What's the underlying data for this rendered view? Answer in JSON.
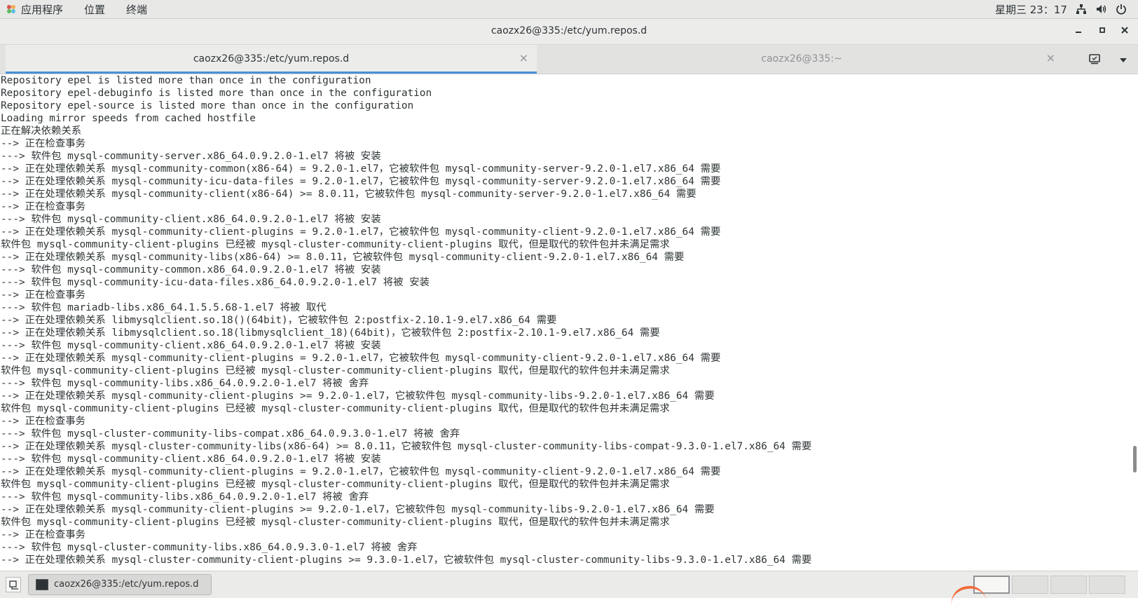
{
  "topbar": {
    "menus": [
      "应用程序",
      "位置",
      "终端"
    ],
    "clock": "星期三 23：17",
    "icons": [
      "apps-icon",
      "network-icon",
      "volume-icon",
      "power-icon"
    ]
  },
  "window": {
    "title": "caozx26@335:/etc/yum.repos.d"
  },
  "tabs": [
    {
      "label": "caozx26@335:/etc/yum.repos.d",
      "active": true
    },
    {
      "label": "caozx26@335:~",
      "active": false
    }
  ],
  "terminal": {
    "lines": [
      "Repository epel is listed more than once in the configuration",
      "Repository epel-debuginfo is listed more than once in the configuration",
      "Repository epel-source is listed more than once in the configuration",
      "Loading mirror speeds from cached hostfile",
      "正在解决依赖关系",
      "--> 正在检查事务",
      "---> 软件包 mysql-community-server.x86_64.0.9.2.0-1.el7 将被 安装",
      "--> 正在处理依赖关系 mysql-community-common(x86-64) = 9.2.0-1.el7，它被软件包 mysql-community-server-9.2.0-1.el7.x86_64 需要",
      "--> 正在处理依赖关系 mysql-community-icu-data-files = 9.2.0-1.el7，它被软件包 mysql-community-server-9.2.0-1.el7.x86_64 需要",
      "--> 正在处理依赖关系 mysql-community-client(x86-64) >= 8.0.11，它被软件包 mysql-community-server-9.2.0-1.el7.x86_64 需要",
      "--> 正在检查事务",
      "---> 软件包 mysql-community-client.x86_64.0.9.2.0-1.el7 将被 安装",
      "--> 正在处理依赖关系 mysql-community-client-plugins = 9.2.0-1.el7，它被软件包 mysql-community-client-9.2.0-1.el7.x86_64 需要",
      "软件包 mysql-community-client-plugins 已经被 mysql-cluster-community-client-plugins 取代，但是取代的软件包并未满足需求",
      "--> 正在处理依赖关系 mysql-community-libs(x86-64) >= 8.0.11，它被软件包 mysql-community-client-9.2.0-1.el7.x86_64 需要",
      "---> 软件包 mysql-community-common.x86_64.0.9.2.0-1.el7 将被 安装",
      "---> 软件包 mysql-community-icu-data-files.x86_64.0.9.2.0-1.el7 将被 安装",
      "--> 正在检查事务",
      "---> 软件包 mariadb-libs.x86_64.1.5.5.68-1.el7 将被 取代",
      "--> 正在处理依赖关系 libmysqlclient.so.18()(64bit)，它被软件包 2:postfix-2.10.1-9.el7.x86_64 需要",
      "--> 正在处理依赖关系 libmysqlclient.so.18(libmysqlclient_18)(64bit)，它被软件包 2:postfix-2.10.1-9.el7.x86_64 需要",
      "---> 软件包 mysql-community-client.x86_64.0.9.2.0-1.el7 将被 安装",
      "--> 正在处理依赖关系 mysql-community-client-plugins = 9.2.0-1.el7，它被软件包 mysql-community-client-9.2.0-1.el7.x86_64 需要",
      "软件包 mysql-community-client-plugins 已经被 mysql-cluster-community-client-plugins 取代，但是取代的软件包并未满足需求",
      "---> 软件包 mysql-community-libs.x86_64.0.9.2.0-1.el7 将被 舍弃",
      "--> 正在处理依赖关系 mysql-community-client-plugins >= 9.2.0-1.el7，它被软件包 mysql-community-libs-9.2.0-1.el7.x86_64 需要",
      "软件包 mysql-community-client-plugins 已经被 mysql-cluster-community-client-plugins 取代，但是取代的软件包并未满足需求",
      "--> 正在检查事务",
      "---> 软件包 mysql-cluster-community-libs-compat.x86_64.0.9.3.0-1.el7 将被 舍弃",
      "--> 正在处理依赖关系 mysql-cluster-community-libs(x86-64) >= 8.0.11，它被软件包 mysql-cluster-community-libs-compat-9.3.0-1.el7.x86_64 需要",
      "---> 软件包 mysql-community-client.x86_64.0.9.2.0-1.el7 将被 安装",
      "--> 正在处理依赖关系 mysql-community-client-plugins = 9.2.0-1.el7，它被软件包 mysql-community-client-9.2.0-1.el7.x86_64 需要",
      "软件包 mysql-community-client-plugins 已经被 mysql-cluster-community-client-plugins 取代，但是取代的软件包并未满足需求",
      "---> 软件包 mysql-community-libs.x86_64.0.9.2.0-1.el7 将被 舍弃",
      "--> 正在处理依赖关系 mysql-community-client-plugins >= 9.2.0-1.el7，它被软件包 mysql-community-libs-9.2.0-1.el7.x86_64 需要",
      "软件包 mysql-community-client-plugins 已经被 mysql-cluster-community-client-plugins 取代，但是取代的软件包并未满足需求",
      "--> 正在检查事务",
      "---> 软件包 mysql-cluster-community-libs.x86_64.0.9.3.0-1.el7 将被 舍弃",
      "--> 正在处理依赖关系 mysql-cluster-community-client-plugins >= 9.3.0-1.el7，它被软件包 mysql-cluster-community-libs-9.3.0-1.el7.x86_64 需要"
    ]
  },
  "taskbar": {
    "task_label": "caozx26@335:/etc/yum.repos.d",
    "workspaces": 4,
    "active_workspace": 1
  },
  "colors": {
    "accent": "#4a90d9",
    "annotation": "#f26b3a"
  }
}
